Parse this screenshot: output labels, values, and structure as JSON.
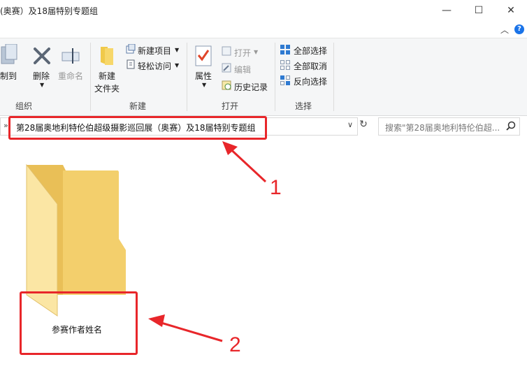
{
  "window": {
    "title": "(奥赛）及18届特别专题组",
    "minimize": "—",
    "maximize": "☐",
    "close": "✕",
    "help": "?"
  },
  "ribbon": {
    "organize": {
      "label": "组织",
      "copy_to": "复制到",
      "delete": "删除",
      "rename": "重命名"
    },
    "new": {
      "label": "新建",
      "new_folder_line1": "新建",
      "new_folder_line2": "文件夹",
      "new_item": "新建项目",
      "easy_access": "轻松访问"
    },
    "open": {
      "label": "打开",
      "properties": "属性",
      "open": "打开",
      "edit": "编辑",
      "history": "历史记录"
    },
    "select": {
      "label": "选择",
      "select_all": "全部选择",
      "select_none": "全部取消",
      "invert": "反向选择"
    }
  },
  "address_bar": {
    "path": "第28届奥地利特伦伯超级摄影巡回展（奥赛）及18届特别专题组",
    "separator": "»"
  },
  "search": {
    "placeholder": "搜索\"第28届奥地利特伦伯超..."
  },
  "content": {
    "folder_name": "参赛作者姓名"
  },
  "annotations": {
    "label_1": "1",
    "label_2": "2",
    "color": "#e8262a"
  }
}
